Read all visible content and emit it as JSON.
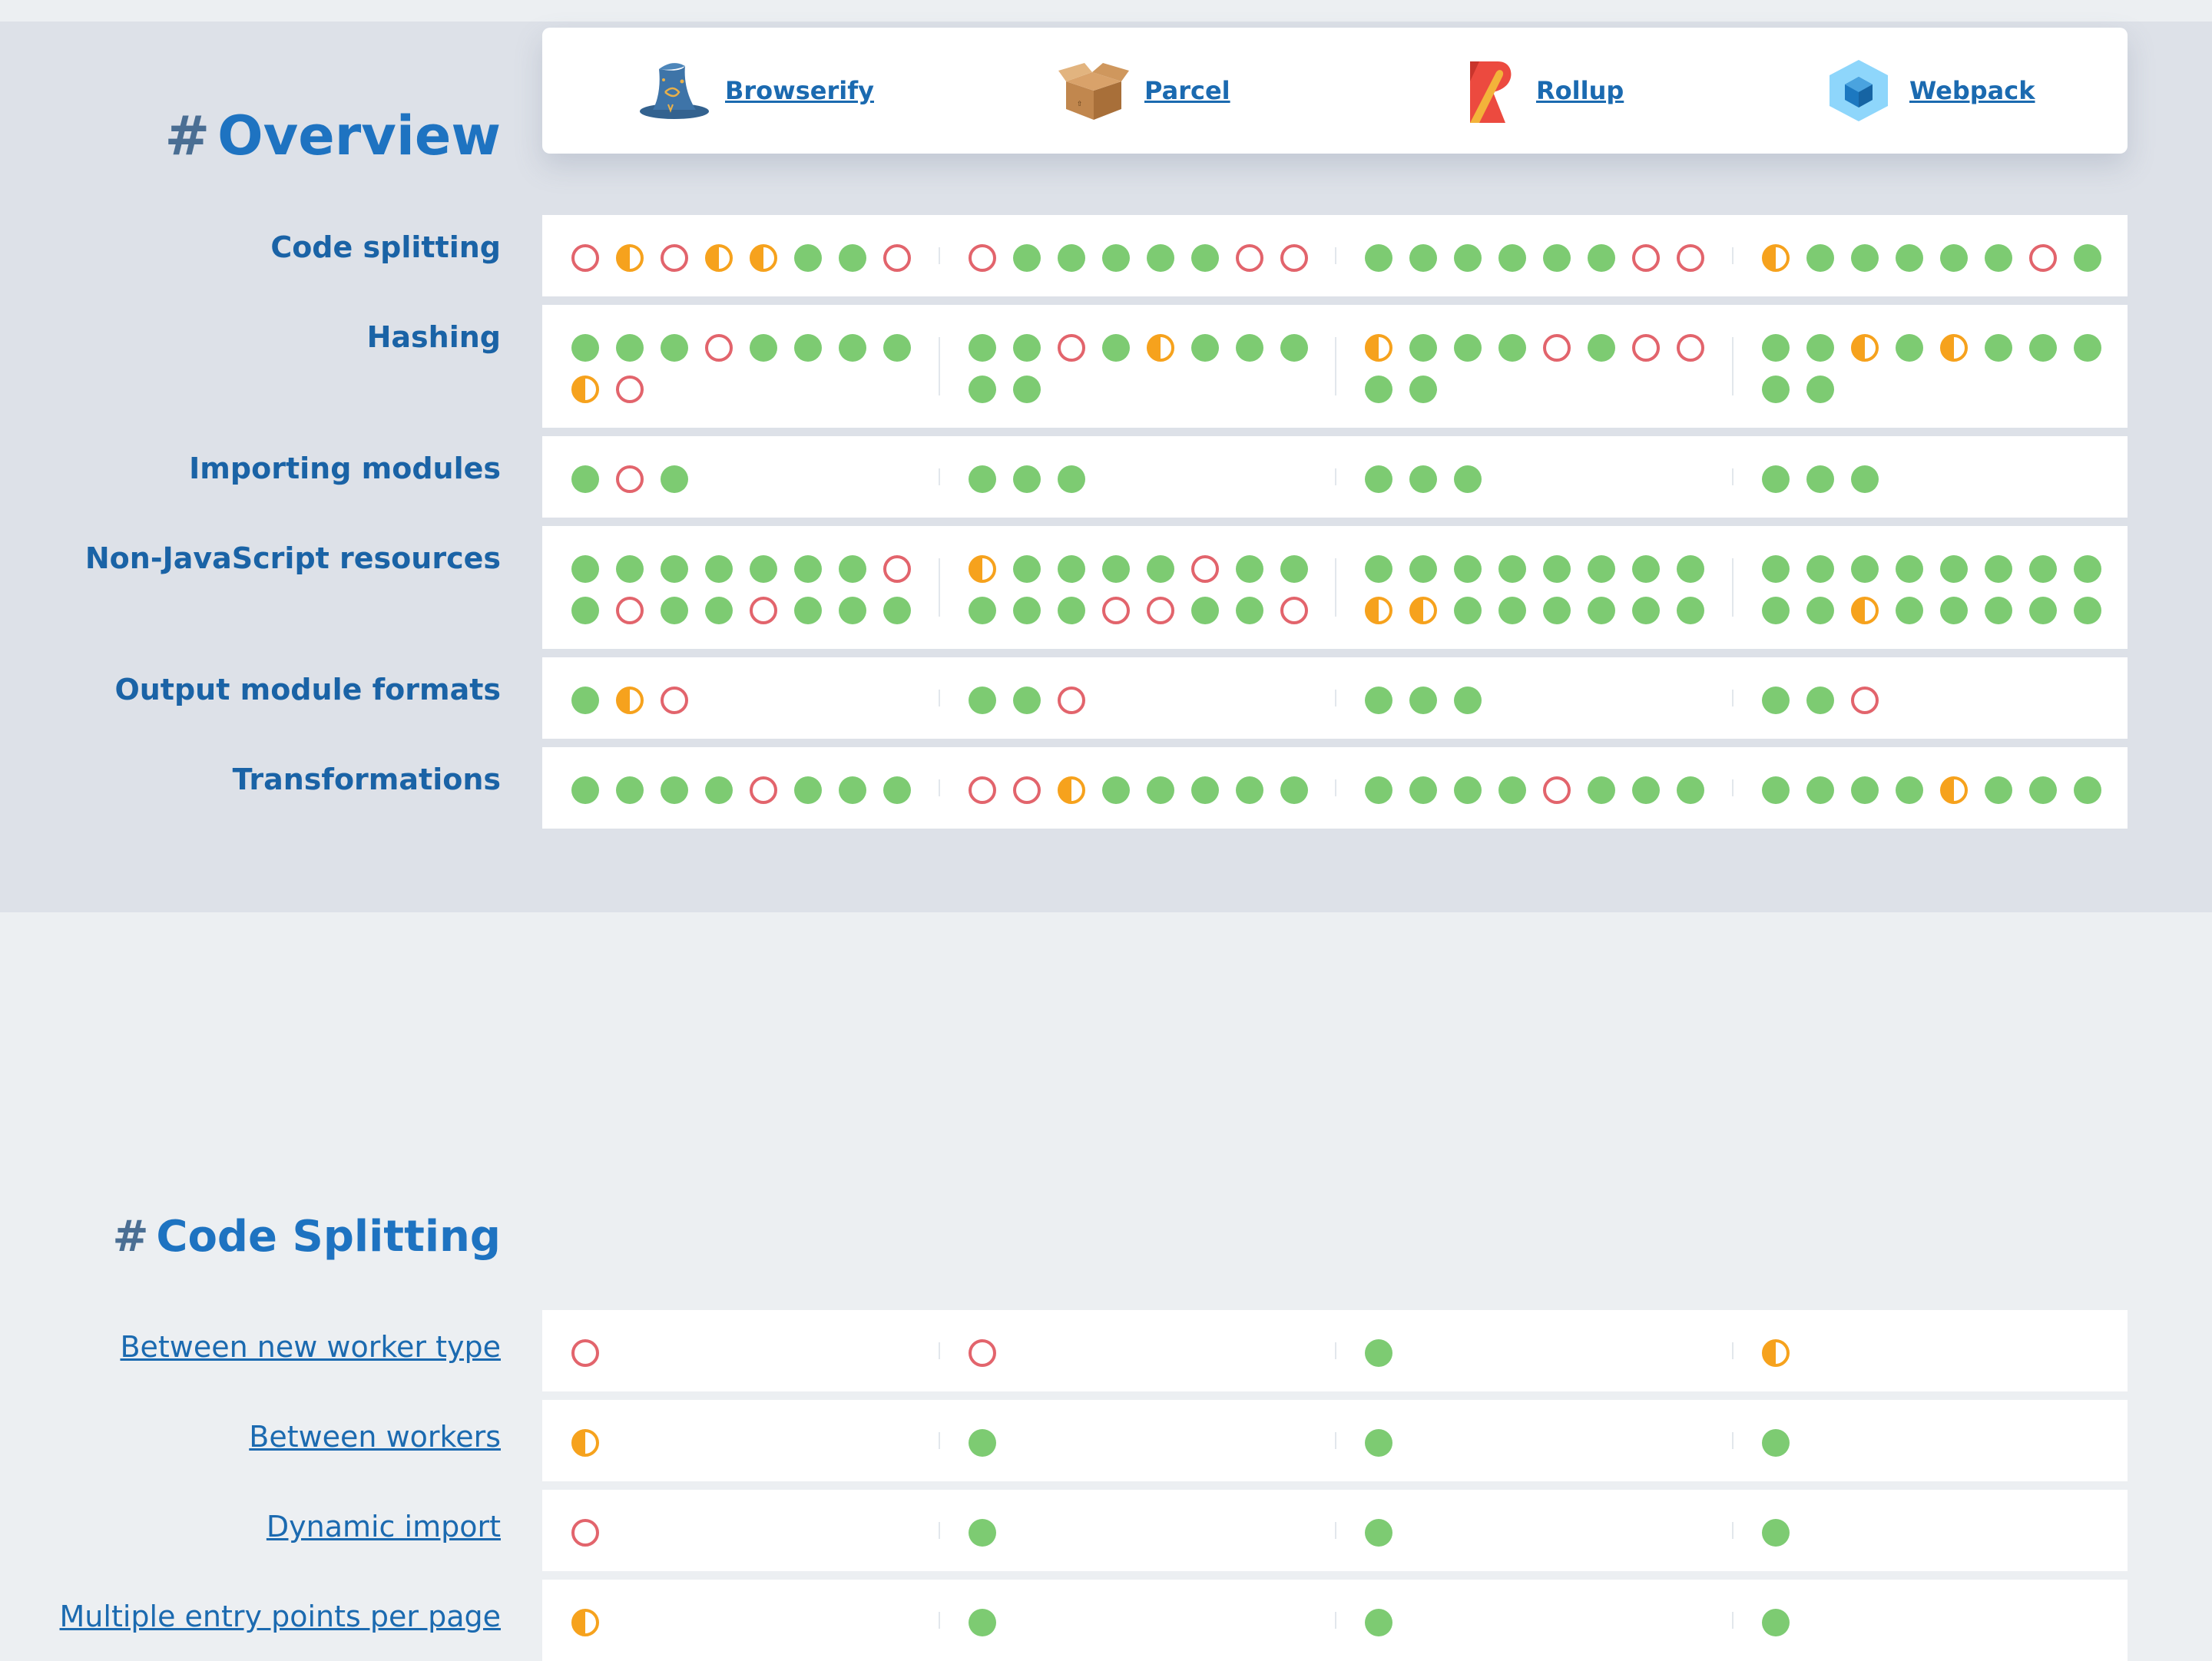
{
  "tools": [
    {
      "name": "Browserify",
      "logo": "wizard-hat-icon"
    },
    {
      "name": "Parcel",
      "logo": "cardboard-box-icon"
    },
    {
      "name": "Rollup",
      "logo": "rollup-scroll-icon"
    },
    {
      "name": "Webpack",
      "logo": "webpack-cube-icon"
    }
  ],
  "legend_colors": {
    "full": "#7dcb72",
    "partial": "#f6a21d",
    "none": "#e2646c"
  },
  "sections": [
    {
      "hash": "#",
      "title": "Overview",
      "rows": [
        {
          "label": "Code splitting",
          "cells": [
            [
              "none",
              "partial",
              "none",
              "partial",
              "partial",
              "full",
              "full",
              "none"
            ],
            [
              "none",
              "full",
              "full",
              "full",
              "full",
              "full",
              "none",
              "none"
            ],
            [
              "full",
              "full",
              "full",
              "full",
              "full",
              "full",
              "none",
              "none"
            ],
            [
              "partial",
              "full",
              "full",
              "full",
              "full",
              "full",
              "none",
              "full"
            ]
          ]
        },
        {
          "label": "Hashing",
          "cells": [
            [
              "full",
              "full",
              "full",
              "none",
              "full",
              "full",
              "full",
              "full",
              "partial",
              "none"
            ],
            [
              "full",
              "full",
              "none",
              "full",
              "partial",
              "full",
              "full",
              "full",
              "full",
              "full"
            ],
            [
              "partial",
              "full",
              "full",
              "full",
              "none",
              "full",
              "none",
              "none",
              "full",
              "full"
            ],
            [
              "full",
              "full",
              "partial",
              "full",
              "partial",
              "full",
              "full",
              "full",
              "full",
              "full"
            ]
          ]
        },
        {
          "label": "Importing modules",
          "cells": [
            [
              "full",
              "none",
              "full"
            ],
            [
              "full",
              "full",
              "full"
            ],
            [
              "full",
              "full",
              "full"
            ],
            [
              "full",
              "full",
              "full"
            ]
          ]
        },
        {
          "label": "Non-JavaScript resources",
          "cells": [
            [
              "full",
              "full",
              "full",
              "full",
              "full",
              "full",
              "full",
              "none",
              "full",
              "none",
              "full",
              "full",
              "none",
              "full",
              "full",
              "full"
            ],
            [
              "partial",
              "full",
              "full",
              "full",
              "full",
              "none",
              "full",
              "full",
              "full",
              "full",
              "full",
              "none",
              "none",
              "full",
              "full",
              "none"
            ],
            [
              "full",
              "full",
              "full",
              "full",
              "full",
              "full",
              "full",
              "full",
              "partial",
              "partial",
              "full",
              "full",
              "full",
              "full",
              "full",
              "full"
            ],
            [
              "full",
              "full",
              "full",
              "full",
              "full",
              "full",
              "full",
              "full",
              "full",
              "full",
              "partial",
              "full",
              "full",
              "full",
              "full",
              "full"
            ]
          ]
        },
        {
          "label": "Output module formats",
          "cells": [
            [
              "full",
              "partial",
              "none"
            ],
            [
              "full",
              "full",
              "none"
            ],
            [
              "full",
              "full",
              "full"
            ],
            [
              "full",
              "full",
              "none"
            ]
          ]
        },
        {
          "label": "Transformations",
          "cells": [
            [
              "full",
              "full",
              "full",
              "full",
              "none",
              "full",
              "full",
              "full"
            ],
            [
              "none",
              "none",
              "partial",
              "full",
              "full",
              "full",
              "full",
              "full"
            ],
            [
              "full",
              "full",
              "full",
              "full",
              "none",
              "full",
              "full",
              "full"
            ],
            [
              "full",
              "full",
              "full",
              "full",
              "partial",
              "full",
              "full",
              "full"
            ]
          ]
        }
      ]
    },
    {
      "hash": "#",
      "title": "Code Splitting",
      "rows": [
        {
          "label": "Between new worker type",
          "cells": [
            [
              "none"
            ],
            [
              "none"
            ],
            [
              "full"
            ],
            [
              "partial"
            ]
          ]
        },
        {
          "label": "Between workers",
          "cells": [
            [
              "partial"
            ],
            [
              "full"
            ],
            [
              "full"
            ],
            [
              "full"
            ]
          ]
        },
        {
          "label": "Dynamic import",
          "cells": [
            [
              "none"
            ],
            [
              "full"
            ],
            [
              "full"
            ],
            [
              "full"
            ]
          ]
        },
        {
          "label": "Multiple entry points per page",
          "cells": [
            [
              "partial"
            ],
            [
              "full"
            ],
            [
              "full"
            ],
            [
              "full"
            ]
          ]
        }
      ]
    }
  ]
}
